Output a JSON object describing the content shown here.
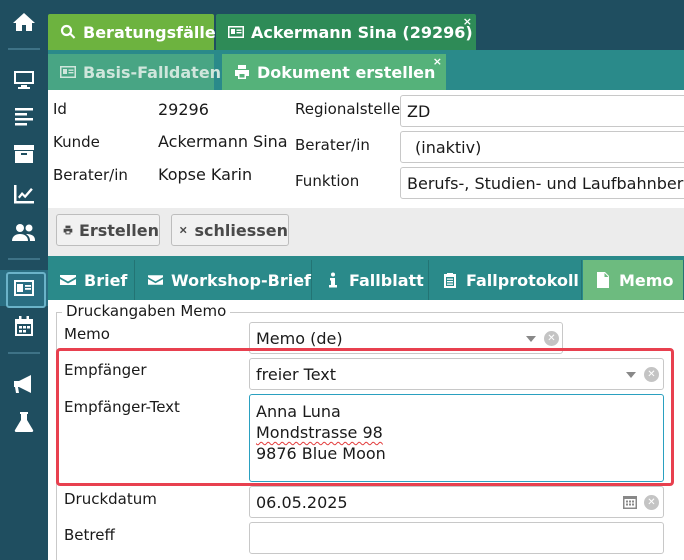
{
  "tabs_top": {
    "beratungsfaelle": "Beratungsfälle",
    "ackermann": "Ackermann Sina (29296)",
    "close": "×"
  },
  "tabs_second": {
    "basis": "Basis-Falldaten",
    "dokument": "Dokument erstellen",
    "close": "×"
  },
  "info": {
    "id_label": "Id",
    "id_value": "29296",
    "kunde_label": "Kunde",
    "kunde_value": "Ackermann Sina",
    "berater_label": "Berater/in",
    "berater_value": "Kopse Karin",
    "regional_label": "Regionalstelle",
    "regional_value": "ZD",
    "berater2_label": "Berater/in",
    "berater2_value": "(inaktiv)",
    "funktion_label": "Funktion",
    "funktion_value": "Berufs-, Studien- und Laufbahnbera"
  },
  "toolbar": {
    "erstellen": "Erstellen",
    "schliessen": "schliessen"
  },
  "doc_tabs": [
    "Brief",
    "Workshop-Brief",
    "Fallblatt",
    "Fallprotokoll",
    "Memo"
  ],
  "form": {
    "legend": "Druckangaben Memo",
    "memo_label": "Memo",
    "memo_value": "Memo (de)",
    "empfaenger_label": "Empfänger",
    "empfaenger_value": "freier Text",
    "empfaenger_text_label": "Empfänger-Text",
    "empfaenger_lines": [
      "Anna Luna",
      "Mondstrasse 98",
      "9876 Blue Moon"
    ],
    "druckdatum_label": "Druckdatum",
    "druckdatum_value": "06.05.2025",
    "betreff_label": "Betreff",
    "betreff_value": ""
  },
  "colors": {
    "sidebar": "#1f4e60",
    "teal": "#2a8a8a",
    "green_active_tab": "#6dbb7f",
    "highlight": "#e8404f"
  },
  "sidebar_icons": [
    "home-icon",
    "monitor-icon",
    "text-lines-icon",
    "archive-icon",
    "chart-line-icon",
    "users-icon",
    "id-card-icon",
    "calendar-icon",
    "megaphone-icon",
    "flask-icon"
  ]
}
